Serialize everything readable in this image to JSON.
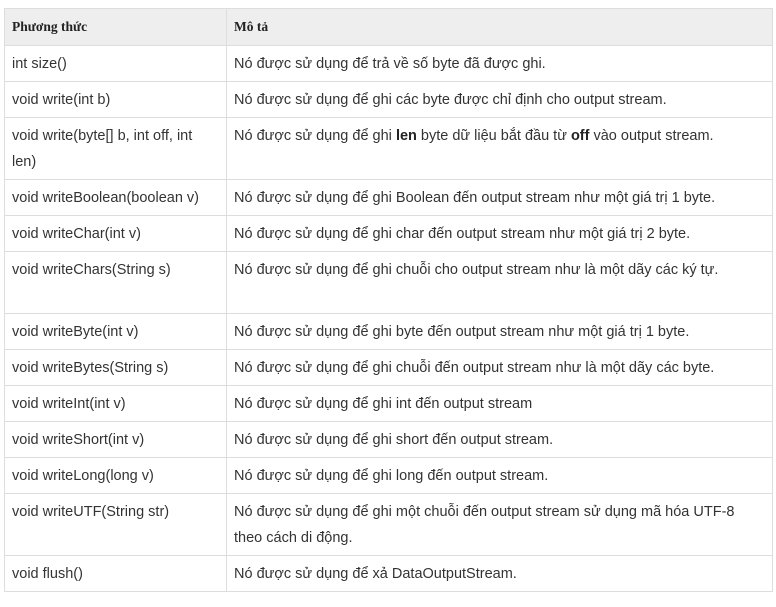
{
  "table": {
    "headers": {
      "method": "Phương thức",
      "description": "Mô tả"
    },
    "rows": [
      {
        "method": "int size()",
        "description": "Nó được sử dụng để trả về số byte đã được ghi."
      },
      {
        "method": "void write(int b)",
        "description": "Nó được sử dụng để ghi các byte được chỉ định cho output stream."
      },
      {
        "method": "void write(byte[] b, int off, int len)",
        "description": {
          "pre": "Nó được sử dụng để ghi ",
          "bold1": "len",
          "mid": " byte dữ liệu bắt đầu từ ",
          "bold2": "off",
          "post": " vào output stream."
        }
      },
      {
        "method": "void writeBoolean(boolean v)",
        "description": "Nó được sử dụng để ghi Boolean đến output stream như một giá trị 1 byte."
      },
      {
        "method": "void writeChar(int v)",
        "description": "Nó được sử dụng để ghi char đến output stream như một giá trị 2 byte."
      },
      {
        "method": "void writeChars(String s)",
        "description": "Nó được sử dụng để ghi chuỗi cho output stream như là một dãy các ký tự."
      },
      {
        "method": "void writeByte(int v)",
        "description": "Nó được sử dụng để ghi byte đến output stream như một giá trị 1 byte."
      },
      {
        "method": "void writeBytes(String s)",
        "description": "Nó được sử dụng để ghi chuỗi đến output stream như là một dãy các byte."
      },
      {
        "method": "void writeInt(int v)",
        "description": "Nó được sử dụng để ghi int đến output stream"
      },
      {
        "method": "void writeShort(int v)",
        "description": "Nó được sử dụng để ghi short đến output stream."
      },
      {
        "method": "void writeLong(long v)",
        "description": "Nó được sử dụng để ghi long đến output stream."
      },
      {
        "method": "void writeUTF(String str)",
        "description": "Nó được sử dụng để ghi một chuỗi đến output stream sử dụng mã hóa UTF-8 theo cách di động."
      },
      {
        "method": "void flush()",
        "description": "Nó được sử dụng để xả DataOutputStream."
      }
    ]
  }
}
